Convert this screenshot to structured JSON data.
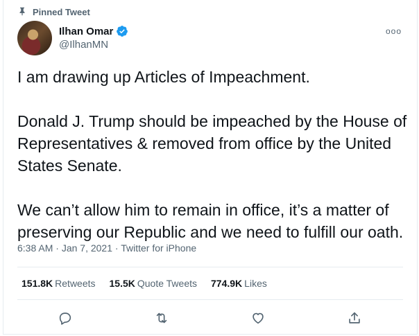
{
  "pinned_label": "Pinned Tweet",
  "author": {
    "display_name": "Ilhan Omar",
    "handle": "@IlhanMN",
    "verified": true
  },
  "more_label": "ooo",
  "tweet": {
    "paragraphs": [
      "I am drawing up Articles of Impeachment.",
      "Donald J. Trump should be impeached by the House of Representatives & removed from office by the United States Senate.",
      "We can’t allow him to remain in office, it’s a matter of preserving our Republic and we need to fulfill our oath."
    ]
  },
  "meta": {
    "time": "6:38 AM",
    "separator1": " · ",
    "date": "Jan 7, 2021",
    "separator2": " · ",
    "source": "Twitter for iPhone"
  },
  "stats": {
    "retweets_count": "151.8K",
    "retweets_label": "Retweets",
    "quotes_count": "15.5K",
    "quotes_label": "Quote Tweets",
    "likes_count": "774.9K",
    "likes_label": "Likes"
  },
  "colors": {
    "verified_blue": "#1d9bf0",
    "secondary_text": "#536471",
    "border": "#e6ecf0"
  },
  "icons": [
    "pin-icon",
    "verified-badge-icon",
    "reply-icon",
    "retweet-icon",
    "like-icon",
    "share-icon"
  ]
}
